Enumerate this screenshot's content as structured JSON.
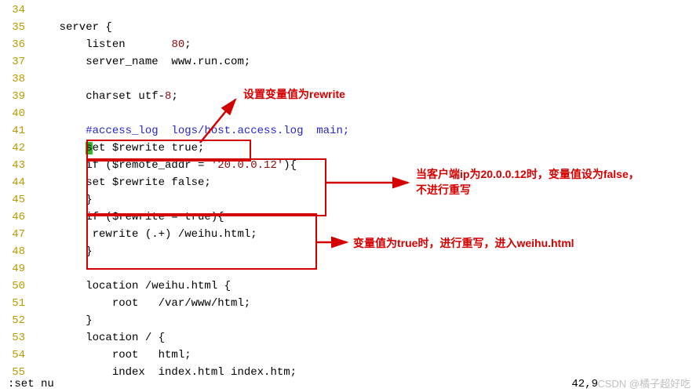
{
  "lines": [
    {
      "no": "34",
      "segs": [
        {
          "t": ""
        }
      ]
    },
    {
      "no": "35",
      "segs": [
        {
          "t": "    server {"
        }
      ]
    },
    {
      "no": "36",
      "segs": [
        {
          "t": "        listen       "
        },
        {
          "t": "80",
          "c": "num"
        },
        {
          "t": ";"
        }
      ]
    },
    {
      "no": "37",
      "segs": [
        {
          "t": "        server_name  www.run.com;"
        }
      ]
    },
    {
      "no": "38",
      "segs": [
        {
          "t": ""
        }
      ]
    },
    {
      "no": "39",
      "segs": [
        {
          "t": "        charset utf-"
        },
        {
          "t": "8",
          "c": "num"
        },
        {
          "t": ";"
        }
      ]
    },
    {
      "no": "40",
      "segs": [
        {
          "t": ""
        }
      ]
    },
    {
      "no": "41",
      "segs": [
        {
          "t": "        "
        },
        {
          "t": "#access_log  logs/host.access.log  main;",
          "c": "cmt"
        }
      ]
    },
    {
      "no": "42",
      "segs": [
        {
          "t": "        "
        },
        {
          "t": "s",
          "c": "hlcursor"
        },
        {
          "t": "et $rewrite true;"
        }
      ]
    },
    {
      "no": "43",
      "segs": [
        {
          "t": "        if ($remote_addr = "
        },
        {
          "t": "'20.0.0.12'",
          "c": "str"
        },
        {
          "t": "){"
        }
      ]
    },
    {
      "no": "44",
      "segs": [
        {
          "t": "        set $rewrite false;"
        }
      ]
    },
    {
      "no": "45",
      "segs": [
        {
          "t": "        }"
        }
      ]
    },
    {
      "no": "46",
      "segs": [
        {
          "t": "        if ($rewrite = true){"
        }
      ]
    },
    {
      "no": "47",
      "segs": [
        {
          "t": "         rewrite (.+) /weihu.html;"
        }
      ]
    },
    {
      "no": "48",
      "segs": [
        {
          "t": "        }"
        }
      ]
    },
    {
      "no": "49",
      "segs": [
        {
          "t": ""
        }
      ]
    },
    {
      "no": "50",
      "segs": [
        {
          "t": "        location /weihu.html {"
        }
      ]
    },
    {
      "no": "51",
      "segs": [
        {
          "t": "            root   /var/www/html;"
        }
      ]
    },
    {
      "no": "52",
      "segs": [
        {
          "t": "        }"
        }
      ]
    },
    {
      "no": "53",
      "segs": [
        {
          "t": "        location / {"
        }
      ]
    },
    {
      "no": "54",
      "segs": [
        {
          "t": "            root   html;"
        }
      ]
    },
    {
      "no": "55",
      "segs": [
        {
          "t": "            index  index.html index.htm;"
        }
      ]
    }
  ],
  "annotations": {
    "a1": "设置变量值为rewrite",
    "a2": "当客户端ip为20.0.0.12时，变量值设为false，不进行重写",
    "a3": "变量值为true时，进行重写，进入weihu.html"
  },
  "status_left": ":set nu",
  "status_right": "42,9",
  "watermark": "CSDN @橘子超好吃"
}
